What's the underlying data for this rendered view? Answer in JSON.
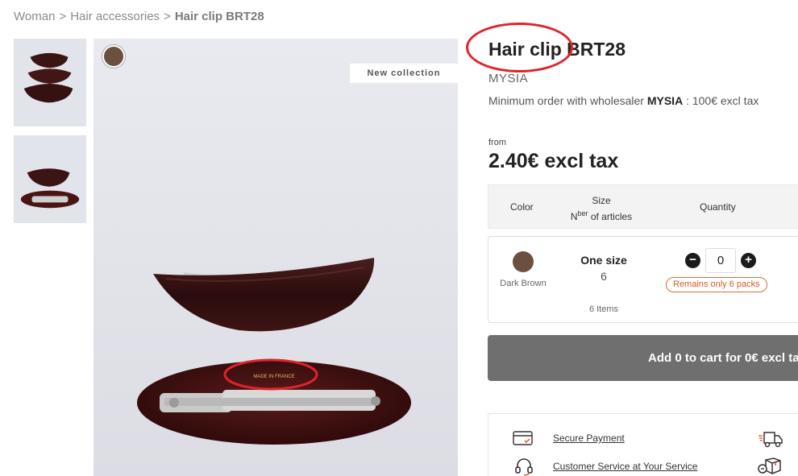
{
  "breadcrumb": {
    "items": [
      "Woman",
      "Hair accessories"
    ],
    "separator": ">",
    "current": "Hair clip BRT28"
  },
  "gallery": {
    "badge": "New collection",
    "swatch_color": "#6b5040",
    "annotation_text": "MADE IN FRANCE"
  },
  "product": {
    "title": "Hair clip BRT28",
    "brand": "MYSIA",
    "min_order_prefix": "Minimum order with wholesaler",
    "min_order_brand": "MYSIA",
    "min_order_suffix": ": 100€ excl tax",
    "price_from": "from",
    "price": "2.40€ excl tax"
  },
  "table": {
    "header_color": "Color",
    "header_size": "Size",
    "header_nber_prefix": "N",
    "header_nber_sup": "ber",
    "header_nber_suffix": " of articles",
    "header_quantity": "Quantity"
  },
  "variant": {
    "color_name": "Dark Brown",
    "color_hex": "#6b5040",
    "size": "One size",
    "count": "6",
    "items": "6 Items",
    "quantity": "0",
    "minus_label": "−",
    "plus_label": "+",
    "stock": "Remains only 6 packs"
  },
  "cart": {
    "label_prefix": "Add ",
    "qty": "0",
    "label_mid": " to cart for ",
    "amount": "0€",
    "label_suffix": " excl tax"
  },
  "info": {
    "secure_payment": "Secure Payment",
    "customer_service": "Customer Service at Your Service"
  },
  "colors": {
    "accent_red": "#e0222b",
    "stock_orange": "#d9592a",
    "cart_bg": "#6f6f6f"
  }
}
